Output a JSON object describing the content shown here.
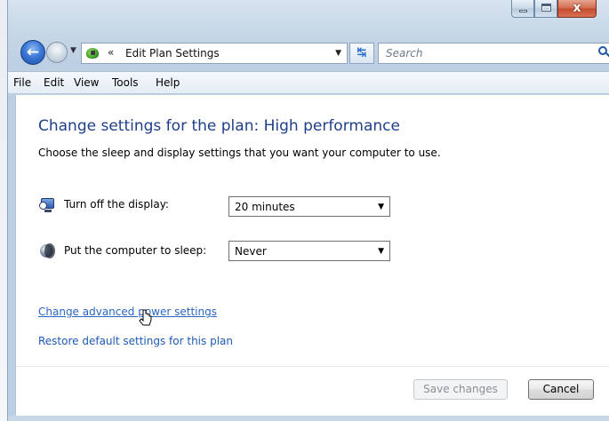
{
  "window": {
    "caption_close_glyph": "x"
  },
  "nav": {
    "address_path_chevron": "«",
    "address_text": "Edit Plan Settings",
    "search_placeholder": "Search"
  },
  "menu": {
    "items": [
      "File",
      "Edit",
      "View",
      "Tools",
      "Help"
    ]
  },
  "content": {
    "heading": "Change settings for the plan: High performance",
    "subtext": "Choose the sleep and display settings that you want your computer to use.",
    "display": {
      "label": "Turn off the display:",
      "value": "20 minutes"
    },
    "sleep": {
      "label": "Put the computer to sleep:",
      "value": "Never"
    },
    "links": {
      "advanced": "Change advanced power settings",
      "restore": "Restore default settings for this plan"
    }
  },
  "buttons": {
    "save": "Save changes",
    "cancel": "Cancel"
  },
  "colors": {
    "heading": "#1e3f8a",
    "link": "#1e5ab6"
  },
  "icons": {
    "back": "back-arrow-icon",
    "forward": "forward-arrow-icon",
    "refresh": "refresh-icon",
    "search": "search-icon",
    "display": "monitor-clock-icon",
    "sleep": "moon-icon",
    "address": "power-options-icon"
  }
}
